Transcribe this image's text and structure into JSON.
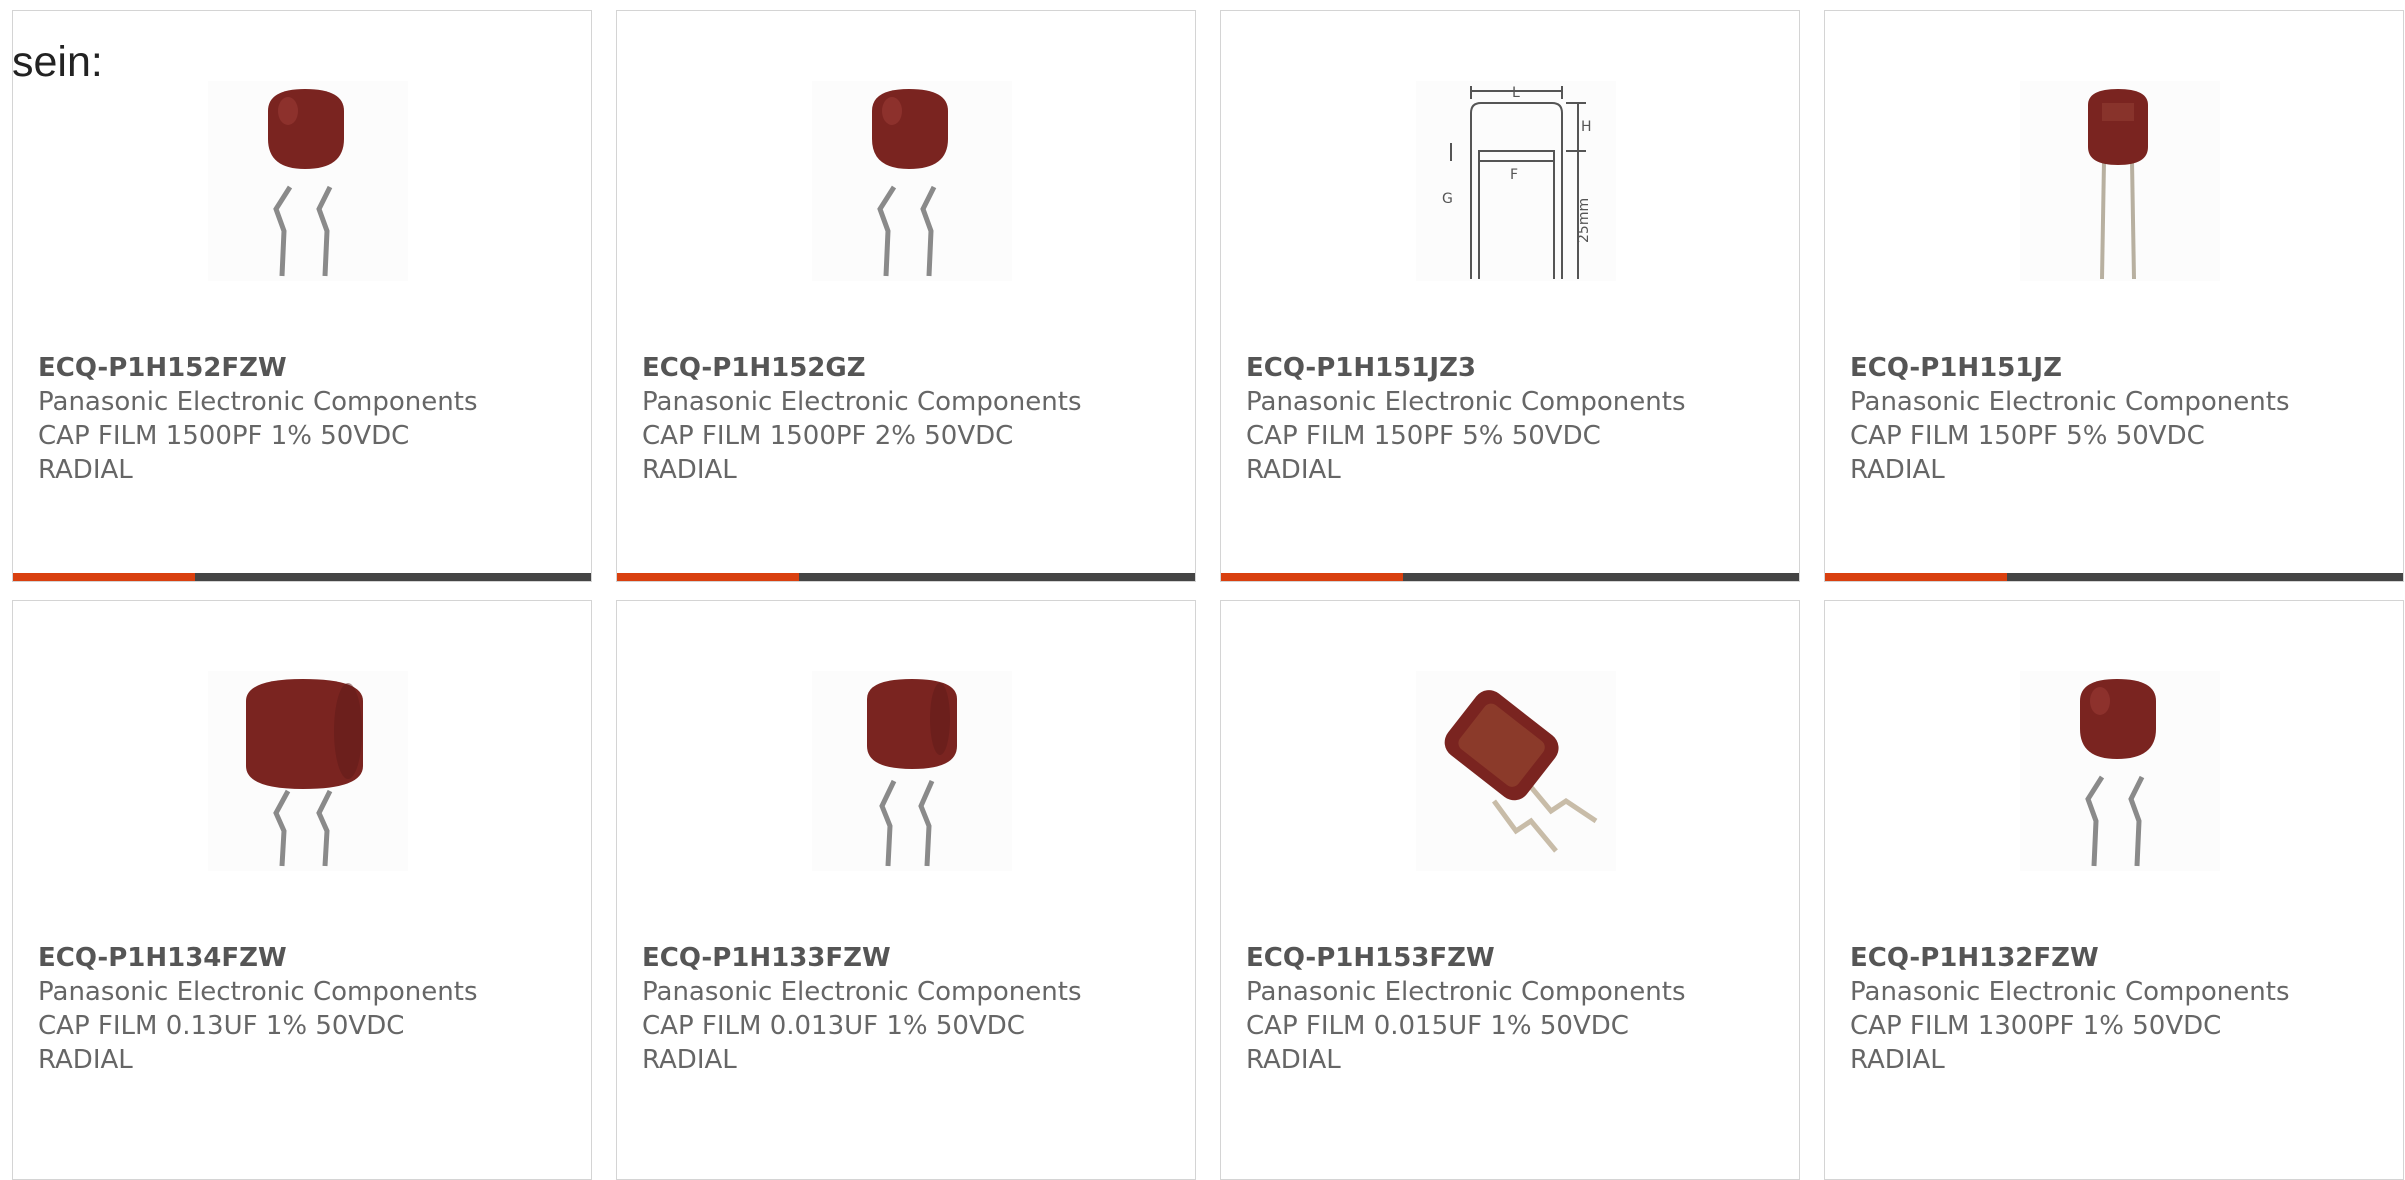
{
  "lead_text": "sein:",
  "colors": {
    "accent": "#d9400f",
    "bar_dark": "#444444",
    "capacitor": "#7a2420",
    "lead": "#8a8a8a"
  },
  "products": [
    {
      "part_number": "ECQ-P1H152FZW",
      "manufacturer": "Panasonic Electronic Components",
      "description": "CAP FILM 1500PF 1% 50VDC RADIAL",
      "image": "dipped-capacitor-kinked-leads-icon"
    },
    {
      "part_number": "ECQ-P1H152GZ",
      "manufacturer": "Panasonic Electronic Components",
      "description": "CAP FILM 1500PF 2% 50VDC RADIAL",
      "image": "dipped-capacitor-kinked-leads-icon"
    },
    {
      "part_number": "ECQ-P1H151JZ3",
      "manufacturer": "Panasonic Electronic Components",
      "description": "CAP FILM 150PF 5% 50VDC RADIAL",
      "image": "dimension-drawing-icon"
    },
    {
      "part_number": "ECQ-P1H151JZ",
      "manufacturer": "Panasonic Electronic Components",
      "description": "CAP FILM 150PF 5% 50VDC RADIAL",
      "image": "dipped-capacitor-straight-leads-icon"
    },
    {
      "part_number": "ECQ-P1H134FZW",
      "manufacturer": "Panasonic Electronic Components",
      "description": "CAP FILM 0.13UF 1% 50VDC RADIAL",
      "image": "large-capacitor-kinked-leads-icon"
    },
    {
      "part_number": "ECQ-P1H133FZW",
      "manufacturer": "Panasonic Electronic Components",
      "description": "CAP FILM 0.013UF 1% 50VDC RADIAL",
      "image": "dipped-capacitor-kinked-leads-icon"
    },
    {
      "part_number": "ECQ-P1H153FZW",
      "manufacturer": "Panasonic Electronic Components",
      "description": "CAP FILM 0.015UF 1% 50VDC RADIAL",
      "image": "tilted-capacitor-icon"
    },
    {
      "part_number": "ECQ-P1H132FZW",
      "manufacturer": "Panasonic Electronic Components",
      "description": "CAP FILM 1300PF 1% 50VDC RADIAL",
      "image": "dipped-capacitor-kinked-leads-icon"
    }
  ],
  "drawing_labels": {
    "l": "L",
    "h": "H",
    "g": "G",
    "f": "F",
    "length": "25mm"
  }
}
